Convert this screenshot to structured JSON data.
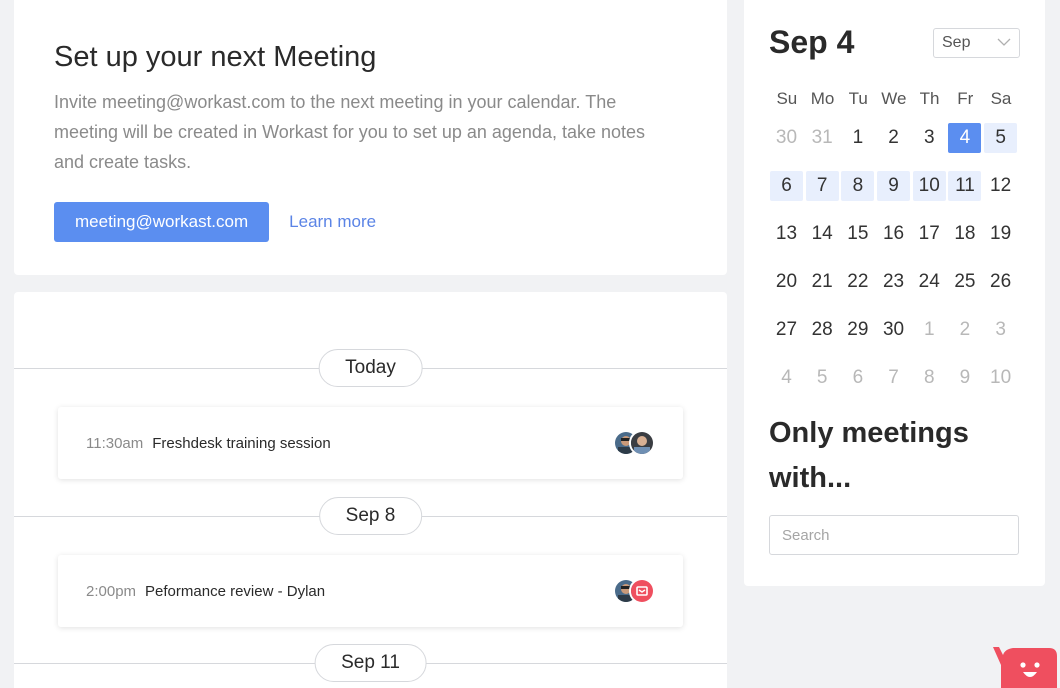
{
  "setup": {
    "title": "Set up your next Meeting",
    "description": "Invite meeting@workast.com to the next meeting in your calendar. The meeting will be created in Workast for you to set up an agenda, take notes and create tasks.",
    "email_button": "meeting@workast.com",
    "learn_more": "Learn more"
  },
  "meetings": {
    "groups": [
      {
        "label": "Today",
        "items": [
          {
            "time": "11:30am",
            "title": "Freshdesk training session",
            "avatars": [
              "user-photo",
              "user-photo"
            ]
          }
        ]
      },
      {
        "label": "Sep 8",
        "items": [
          {
            "time": "2:00pm",
            "title": "Peformance review - Dylan",
            "avatars": [
              "user-photo",
              "red-app-logo"
            ]
          }
        ]
      },
      {
        "label": "Sep 11",
        "items": []
      }
    ]
  },
  "calendar": {
    "heading": "Sep 4",
    "month_select": "Sep",
    "weekdays": [
      "Su",
      "Mo",
      "Tu",
      "We",
      "Th",
      "Fr",
      "Sa"
    ],
    "weeks": [
      [
        "30",
        "31",
        "1",
        "2",
        "3",
        "4",
        "5"
      ],
      [
        "6",
        "7",
        "8",
        "9",
        "10",
        "11",
        "12"
      ],
      [
        "13",
        "14",
        "15",
        "16",
        "17",
        "18",
        "19"
      ],
      [
        "20",
        "21",
        "22",
        "23",
        "24",
        "25",
        "26"
      ],
      [
        "27",
        "28",
        "29",
        "30",
        "1",
        "2",
        "3"
      ],
      [
        "4",
        "5",
        "6",
        "7",
        "8",
        "9",
        "10"
      ]
    ]
  },
  "filter": {
    "title": "Only meetings with...",
    "search_placeholder": "Search"
  },
  "colors": {
    "accent": "#5b8ef0",
    "highlight": "#e8effd",
    "mascot": "#ef4f5f"
  }
}
